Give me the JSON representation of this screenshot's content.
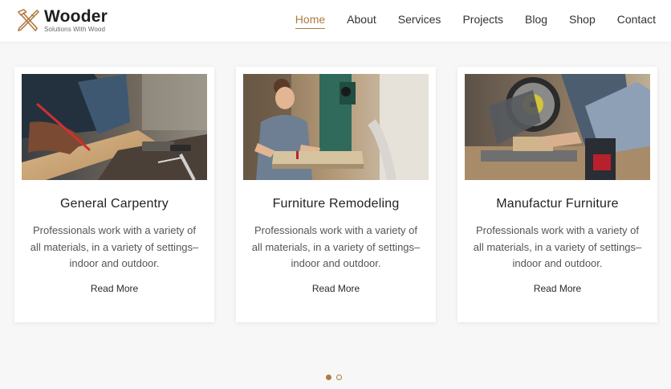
{
  "brand": {
    "name": "Wooder",
    "tagline": "Solutions With Wood",
    "color": "#b07a43"
  },
  "nav": {
    "items": [
      {
        "label": "Home",
        "active": true
      },
      {
        "label": "About",
        "active": false
      },
      {
        "label": "Services",
        "active": false
      },
      {
        "label": "Projects",
        "active": false
      },
      {
        "label": "Blog",
        "active": false
      },
      {
        "label": "Shop",
        "active": false
      },
      {
        "label": "Contact",
        "active": false
      }
    ]
  },
  "services": [
    {
      "title": "General Carpentry",
      "description": "Professionals work with a variety of all materials, in a variety of settings–indoor and outdoor.",
      "link_label": "Read More",
      "image": "carpenter-marking-plank-photo"
    },
    {
      "title": "Furniture Remodeling",
      "description": "Professionals work with a variety of all materials, in a variety of settings–indoor and outdoor.",
      "link_label": "Read More",
      "image": "woman-at-bandsaw-photo"
    },
    {
      "title": "Manufactur Furniture",
      "description": "Professionals work with a variety of all materials, in a variety of settings–indoor and outdoor.",
      "link_label": "Read More",
      "image": "miter-saw-cutting-photo"
    }
  ],
  "pagination": {
    "total": 2,
    "active_index": 0
  },
  "colors": {
    "accent": "#b07a43",
    "page_background": "#f7f7f7",
    "card_background": "#ffffff"
  }
}
